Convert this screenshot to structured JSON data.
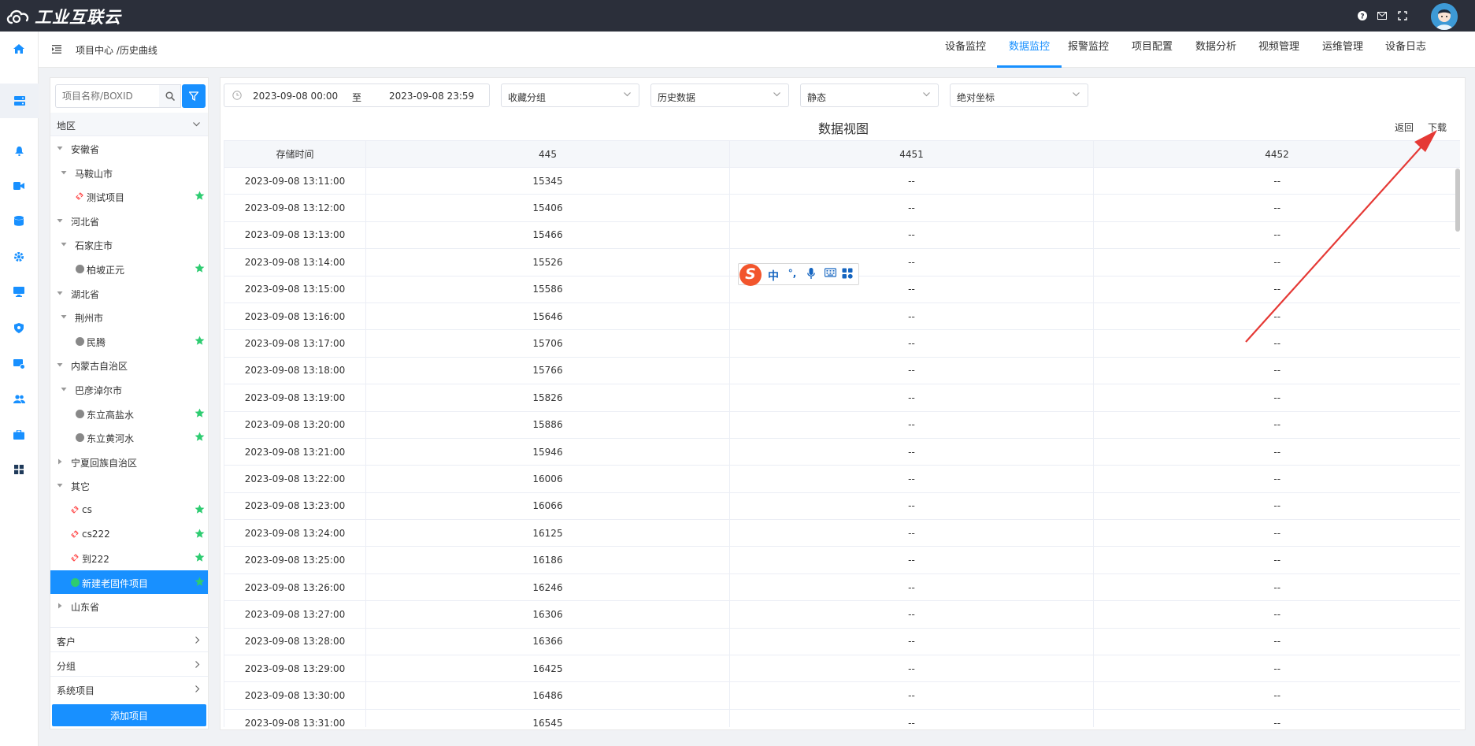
{
  "app": {
    "logo_text": "工业互联云"
  },
  "breadcrumb": "项目中心 /历史曲线",
  "tabs": [
    {
      "label": "设备监控",
      "active": false
    },
    {
      "label": "数据监控",
      "active": true
    },
    {
      "label": "报警监控",
      "active": false
    },
    {
      "label": "项目配置",
      "active": false
    },
    {
      "label": "数据分析",
      "active": false
    },
    {
      "label": "视频管理",
      "active": false
    },
    {
      "label": "运维管理",
      "active": false
    },
    {
      "label": "设备日志",
      "active": false
    }
  ],
  "nav_icons": [
    "home-icon",
    "server-icon",
    "bell-icon",
    "video-icon",
    "database-icon",
    "gear-icon",
    "monitor-icon",
    "shield-icon",
    "screen-gear-icon",
    "users-icon",
    "briefcase-icon",
    "grid-icon"
  ],
  "sidebar": {
    "search_placeholder": "项目名称/BOXID",
    "region_label": "地区",
    "tree": [
      {
        "label": "安徽省",
        "level": 0,
        "expanded": true
      },
      {
        "label": "马鞍山市",
        "level": 1,
        "expanded": true
      },
      {
        "label": "测试项目",
        "level": 2,
        "status": "offline-link",
        "starred": true
      },
      {
        "label": "河北省",
        "level": 0,
        "expanded": true
      },
      {
        "label": "石家庄市",
        "level": 1,
        "expanded": true
      },
      {
        "label": "柏坡正元",
        "level": 2,
        "status": "gray",
        "starred": true
      },
      {
        "label": "湖北省",
        "level": 0,
        "expanded": true
      },
      {
        "label": "荆州市",
        "level": 1,
        "expanded": true
      },
      {
        "label": "民腾",
        "level": 2,
        "status": "gray",
        "starred": true
      },
      {
        "label": "内蒙古自治区",
        "level": 0,
        "expanded": true
      },
      {
        "label": "巴彦淖尔市",
        "level": 1,
        "expanded": true
      },
      {
        "label": "东立高盐水",
        "level": 2,
        "status": "gray",
        "starred": true
      },
      {
        "label": "东立黄河水",
        "level": 2,
        "status": "gray",
        "starred": true
      },
      {
        "label": "宁夏回族自治区",
        "level": 0,
        "expanded": false
      },
      {
        "label": "其它",
        "level": 0,
        "expanded": true
      },
      {
        "label": "cs",
        "level": 1,
        "status": "offline-link",
        "starred": true
      },
      {
        "label": "cs222",
        "level": 1,
        "status": "offline-link",
        "starred": true
      },
      {
        "label": "到222",
        "level": 1,
        "status": "offline-link",
        "starred": true
      },
      {
        "label": "新建老固件项目",
        "level": 1,
        "status": "online",
        "starred": true,
        "selected": true
      },
      {
        "label": "山东省",
        "level": 0,
        "expanded": false
      }
    ],
    "accordions": [
      "客户",
      "分组",
      "系统项目"
    ],
    "add_button": "添加项目"
  },
  "filters": {
    "start_date": "2023-09-08 00:00",
    "range_separator": "至",
    "end_date": "2023-09-08 23:59",
    "favorite_group": "收藏分组",
    "data_type": "历史数据",
    "mode": "静态",
    "axis": "绝对坐标"
  },
  "view": {
    "title": "数据视图",
    "back": "返回",
    "download": "下载"
  },
  "table": {
    "columns": [
      "存储时间",
      "445",
      "4451",
      "4452"
    ],
    "rows": [
      [
        "2023-09-08 13:11:00",
        "15345",
        "--",
        "--"
      ],
      [
        "2023-09-08 13:12:00",
        "15406",
        "--",
        "--"
      ],
      [
        "2023-09-08 13:13:00",
        "15466",
        "--",
        "--"
      ],
      [
        "2023-09-08 13:14:00",
        "15526",
        "--",
        "--"
      ],
      [
        "2023-09-08 13:15:00",
        "15586",
        "--",
        "--"
      ],
      [
        "2023-09-08 13:16:00",
        "15646",
        "--",
        "--"
      ],
      [
        "2023-09-08 13:17:00",
        "15706",
        "--",
        "--"
      ],
      [
        "2023-09-08 13:18:00",
        "15766",
        "--",
        "--"
      ],
      [
        "2023-09-08 13:19:00",
        "15826",
        "--",
        "--"
      ],
      [
        "2023-09-08 13:20:00",
        "15886",
        "--",
        "--"
      ],
      [
        "2023-09-08 13:21:00",
        "15946",
        "--",
        "--"
      ],
      [
        "2023-09-08 13:22:00",
        "16006",
        "--",
        "--"
      ],
      [
        "2023-09-08 13:23:00",
        "16066",
        "--",
        "--"
      ],
      [
        "2023-09-08 13:24:00",
        "16125",
        "--",
        "--"
      ],
      [
        "2023-09-08 13:25:00",
        "16186",
        "--",
        "--"
      ],
      [
        "2023-09-08 13:26:00",
        "16246",
        "--",
        "--"
      ],
      [
        "2023-09-08 13:27:00",
        "16306",
        "--",
        "--"
      ],
      [
        "2023-09-08 13:28:00",
        "16366",
        "--",
        "--"
      ],
      [
        "2023-09-08 13:29:00",
        "16425",
        "--",
        "--"
      ],
      [
        "2023-09-08 13:30:00",
        "16486",
        "--",
        "--"
      ],
      [
        "2023-09-08 13:31:00",
        "16545",
        "--",
        "--"
      ]
    ]
  },
  "ime": {
    "logo": "S",
    "items": [
      "中",
      "°,",
      "mic-icon",
      "keyboard-icon",
      "apps-icon"
    ]
  },
  "colors": {
    "accent": "#1890ff",
    "topbar": "#2b2f3a",
    "star": "#2ecc71",
    "annotation": "#e53935"
  }
}
